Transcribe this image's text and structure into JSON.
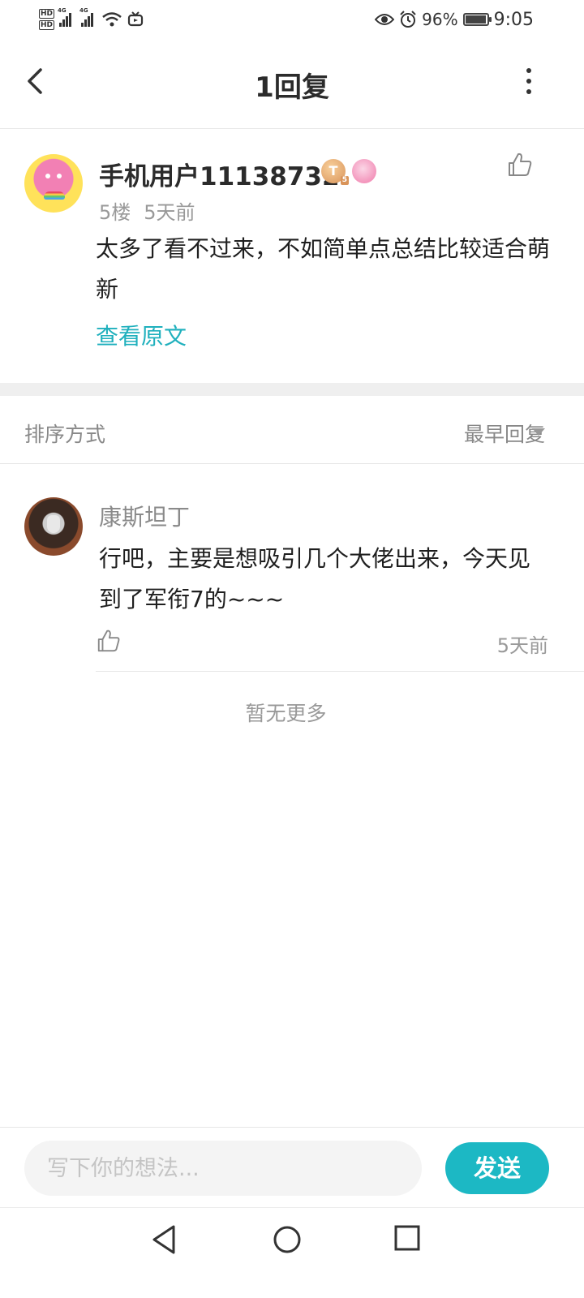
{
  "status_bar": {
    "hd_top": "HD",
    "hd_bottom": "HD",
    "net1": "4G",
    "net2": "4G",
    "battery_pct": "96%",
    "battery_level": 0.96,
    "time": "9:05",
    "icons": [
      "eye-icon",
      "alarm-icon",
      "wifi-icon",
      "tv-icon"
    ]
  },
  "header": {
    "title": "1回复"
  },
  "post": {
    "username": "手机用户11138732",
    "badge_letter": "T",
    "badge_level": "5",
    "floor": "5楼",
    "time": "5天前",
    "text": "太多了看不过来，不如简单点总结比较适合萌新",
    "view_original": "查看原文"
  },
  "sort": {
    "label": "排序方式",
    "value": "最早回复"
  },
  "reply": {
    "username": "康斯坦丁",
    "text": "行吧，主要是想吸引几个大佬出来，今天见到了军衔7的~~~",
    "time": "5天前"
  },
  "no_more": "暂无更多",
  "composer": {
    "placeholder": "写下你的想法...",
    "send_label": "发送"
  },
  "colors": {
    "accent": "#1cb8c4",
    "link": "#1fb0bd"
  }
}
